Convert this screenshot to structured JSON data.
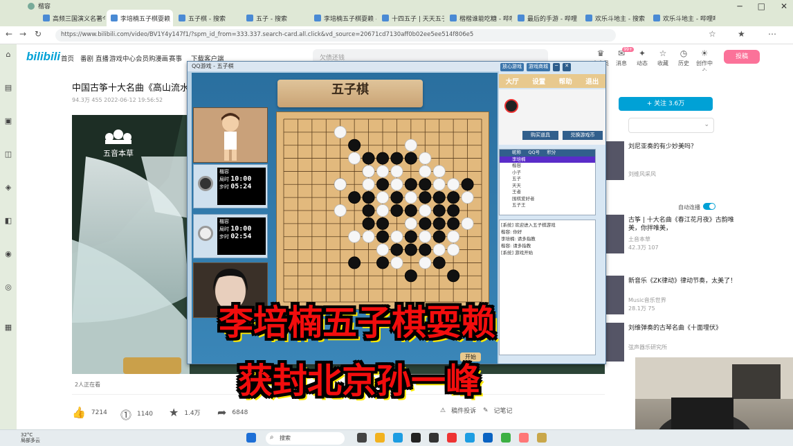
{
  "browser": {
    "profile": "楷容",
    "tabs": [
      {
        "label": "高频三国演义名著今日"
      },
      {
        "label": "李培楠五子棋耍赖"
      },
      {
        "label": "五子棋 - 搜索"
      },
      {
        "label": "五子 - 搜索"
      },
      {
        "label": "李培楠五子棋耍赖 - 哔哩哔哩"
      },
      {
        "label": "十四五子 | 天天五子"
      },
      {
        "label": "楷楷谁能吃糖 - 哔哩哔哩"
      },
      {
        "label": "最后的手游 - 哔哩"
      },
      {
        "label": "欢乐斗地主 - 搜索"
      },
      {
        "label": "欢乐斗地主 - 哔哩哔哩"
      }
    ],
    "url": "https://www.bilibili.com/video/BV1Y4y147f1/?spm_id_from=333.337.search-card.all.click&vd_source=20671cd7130aff0b02ee5ee514f806e5"
  },
  "bilibili": {
    "logo": "bilibili",
    "nav": [
      "首页",
      "番剧",
      "直播",
      "游戏中心",
      "会员购",
      "漫画",
      "赛事",
      "下载客户端"
    ],
    "search_placeholder": "欠债还钱",
    "header_icons": [
      {
        "label": "大会员",
        "icon": "vip-icon"
      },
      {
        "label": "消息",
        "icon": "message-icon",
        "badge": "99+"
      },
      {
        "label": "动态",
        "icon": "dynamic-icon"
      },
      {
        "label": "收藏",
        "icon": "favorite-icon"
      },
      {
        "label": "历史",
        "icon": "history-icon"
      },
      {
        "label": "创作中心",
        "icon": "creator-icon"
      }
    ],
    "upload_label": "投稿"
  },
  "video": {
    "title": "中国古筝十大名曲《高山流水》",
    "stats": "94.3万   455   2022-06-12 19:56:52",
    "player_watermark": "五音本草",
    "danmu_viewers": "2人正在看",
    "actions": {
      "like": "7214",
      "coin": "1140",
      "favorite": "1.4万",
      "share": "6848"
    },
    "report_label": "稿件投诉",
    "note_label": "记笔记"
  },
  "sidebar_right": {
    "follow_button": "+ 关注 3.6万",
    "autoplay_label": "自动连播",
    "items": [
      {
        "title": "刘尼亚奏的有少妙美吗？",
        "meta": "刘维风采风"
      },
      {
        "title": "古筝 | 十大名曲《春江花月夜》古韵唯美，你拌唯美，",
        "meta": "42.3万   107",
        "up": "土音本草"
      },
      {
        "title": "新音乐《ZK律动》律动节奏，太美了！",
        "meta": "28.1万   75",
        "up": "Music音乐世界"
      },
      {
        "title": "刘维弹奏的古琴名曲《十面埋伏》",
        "meta": "",
        "up": "弦声器乐研究所"
      }
    ]
  },
  "game": {
    "window_title": "QQ游戏 - 五子棋",
    "banner": "五子棋",
    "toolbar": [
      "放心游戏",
      "游戏商城"
    ],
    "menu": [
      "大厅",
      "设置",
      "帮助",
      "退出"
    ],
    "players": [
      {
        "label": "楷容",
        "row1": "局时",
        "time1": "10:00",
        "row2": "步时",
        "time2": "05:24"
      },
      {
        "label": "楷容",
        "row1": "局时",
        "time1": "10:00",
        "row2": "步时",
        "time2": "02:54"
      }
    ],
    "buttons": [
      "购买道具",
      "兑换游戏币"
    ],
    "user_list_header": [
      "昵称",
      "QQ号",
      "积分"
    ],
    "users": [
      "李培楠",
      "楷容",
      "小子",
      "五子",
      "天天",
      "王者",
      "围棋爱好者",
      "五子王"
    ],
    "chat_lines": [
      "[系统] 欢迎进入五子棋游戏",
      "楷容: 你好",
      "李培楠: 请多指教",
      "楷容: 请多指教",
      "[系统] 游戏开始"
    ],
    "start_label": "开始"
  },
  "overlay": {
    "line1": "李培楠五子棋耍赖",
    "line2": "获封北京孙一峰"
  },
  "taskbar": {
    "weather_temp": "32°C",
    "weather_text": "局部多云",
    "search": "搜索"
  },
  "stones": {
    "black": [
      [
        5,
        2
      ],
      [
        6,
        3
      ],
      [
        7,
        3
      ],
      [
        8,
        3
      ],
      [
        9,
        3
      ],
      [
        6,
        4
      ],
      [
        4,
        5
      ],
      [
        7,
        5
      ],
      [
        9,
        5
      ],
      [
        10,
        5
      ],
      [
        13,
        5
      ],
      [
        5,
        6
      ],
      [
        6,
        6
      ],
      [
        8,
        6
      ],
      [
        10,
        6
      ],
      [
        11,
        6
      ],
      [
        12,
        6
      ],
      [
        6,
        7
      ],
      [
        8,
        7
      ],
      [
        9,
        7
      ],
      [
        11,
        7
      ],
      [
        12,
        7
      ],
      [
        6,
        8
      ],
      [
        7,
        8
      ],
      [
        9,
        8
      ],
      [
        10,
        8
      ],
      [
        11,
        8
      ],
      [
        12,
        8
      ],
      [
        7,
        9
      ],
      [
        9,
        9
      ],
      [
        11,
        9
      ],
      [
        8,
        10
      ],
      [
        9,
        10
      ],
      [
        10,
        10
      ],
      [
        5,
        11
      ],
      [
        7,
        11
      ],
      [
        11,
        11
      ],
      [
        9,
        12
      ],
      [
        12,
        12
      ]
    ],
    "white": [
      [
        4,
        1
      ],
      [
        9,
        2
      ],
      [
        5,
        3
      ],
      [
        10,
        3
      ],
      [
        6,
        4
      ],
      [
        7,
        4
      ],
      [
        8,
        4
      ],
      [
        10,
        4
      ],
      [
        11,
        4
      ],
      [
        15,
        4
      ],
      [
        4,
        5
      ],
      [
        6,
        5
      ],
      [
        8,
        5
      ],
      [
        11,
        5
      ],
      [
        12,
        5
      ],
      [
        7,
        6
      ],
      [
        9,
        6
      ],
      [
        13,
        6
      ],
      [
        4,
        7
      ],
      [
        7,
        7
      ],
      [
        10,
        7
      ],
      [
        9,
        8
      ],
      [
        13,
        8
      ],
      [
        5,
        9
      ],
      [
        6,
        9
      ],
      [
        8,
        9
      ],
      [
        10,
        9
      ],
      [
        12,
        9
      ],
      [
        7,
        10
      ],
      [
        11,
        10
      ],
      [
        12,
        10
      ],
      [
        8,
        11
      ],
      [
        10,
        11
      ]
    ]
  }
}
